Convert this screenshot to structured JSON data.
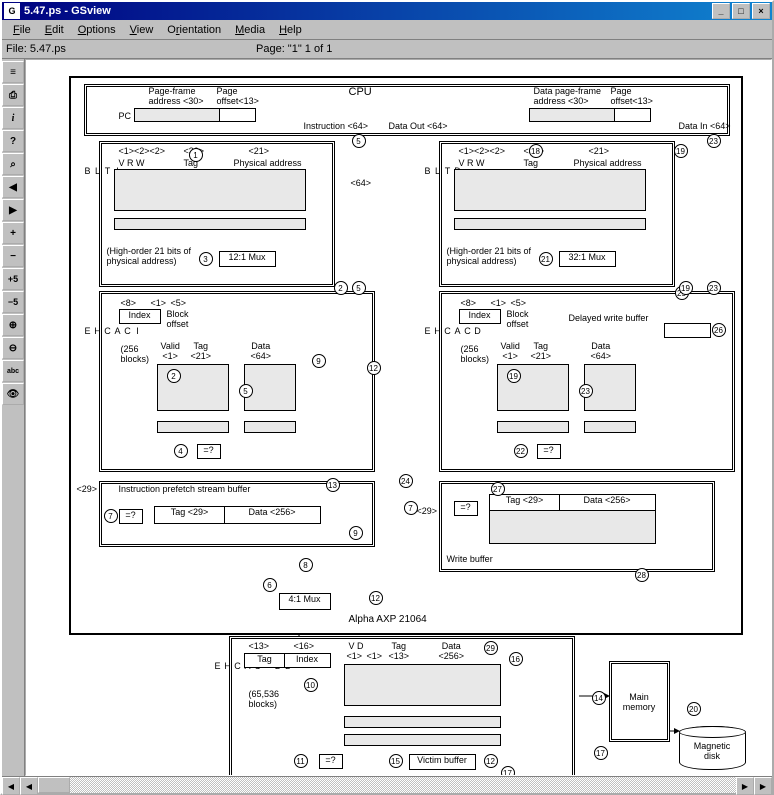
{
  "window": {
    "title": "5.47.ps - GSview"
  },
  "menu": {
    "file": "File",
    "edit": "Edit",
    "options": "Options",
    "view": "View",
    "orientation": "Orientation",
    "media": "Media",
    "help": "Help"
  },
  "info": {
    "file": "File: 5.47.ps",
    "page": "Page: \"1\"  1 of 1"
  },
  "toolbar": {
    "open": "📄",
    "print": "🖶",
    "info": "i",
    "help": "?",
    "find": "🔍",
    "prev": "◀",
    "next": "▶",
    "plus": "+",
    "minus": "−",
    "plus5": "+5",
    "minus5": "−5",
    "zoomin": "🔍+",
    "zoomout": "🔍−",
    "abc": "abc",
    "eye": "👁"
  },
  "diagram": {
    "cpu": "CPU",
    "pc": "PC",
    "pageframe": "Page-frame\naddress <30>",
    "pageoffset": "Page\noffset<13>",
    "instruction": "Instruction <64>",
    "dataout": "Data Out <64>",
    "datain": "Data In <64>",
    "datapageframe": "Data page-frame\naddress <30>",
    "datapageoffset": "Page\noffset<13>",
    "itlb": "I\nT\nL\nB",
    "dtlb": "D\nT\nL\nB",
    "icache": "I\nC\nA\nC\nH\nE",
    "dcache": "D\nC\nA\nC\nH\nE",
    "l2cache": "L\n2\n \nC\nA\nC\nH\nE",
    "vrw": "V  R  W",
    "tag": "Tag",
    "physaddr": "Physical address",
    "bits1": "<1><2><2>",
    "bits30": "<30>",
    "bits21": "<21>",
    "bits64": "<64>",
    "highorder": "(High-order 21 bits of\nphysical address)",
    "mux121": "12:1 Mux",
    "mux321": "32:1 Mux",
    "mux41": "4:1 Mux",
    "index": "Index",
    "blockoffset": "Block\noffset",
    "blocks256": "(256\nblocks)",
    "valid": "Valid\n<1>",
    "tag21": "Tag\n<21>",
    "data64": "Data\n<64>",
    "bits8": "<8>",
    "bits5": "<5>",
    "bits1s": "<1>",
    "delayedwrite": "Delayed write buffer",
    "prefetch": "Instruction prefetch stream buffer",
    "writebuf": "Write buffer",
    "tag29": "Tag <29>",
    "data256": "Data <256>",
    "alpha": "Alpha AXP 21064",
    "bits13": "<13>",
    "bits16": "<16>",
    "vd": "V   D",
    "tag13": "Tag\n<13>",
    "data256b": "Data\n<256>",
    "blocks65536": "(65,536\nblocks)",
    "victim": "Victim buffer",
    "mainmem": "Main\nmemory",
    "disk": "Magnetic\ndisk",
    "bits29": "<29>",
    "eq": "=?"
  }
}
